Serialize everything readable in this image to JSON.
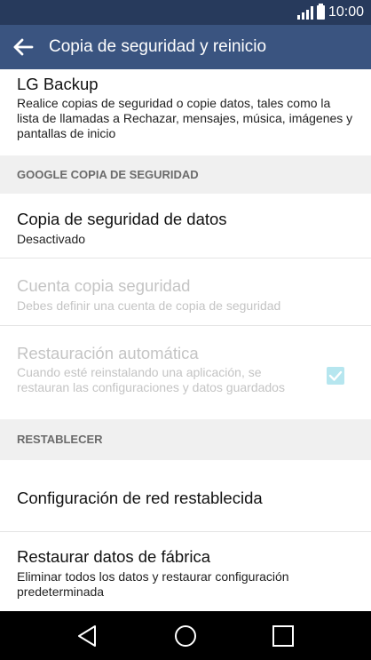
{
  "status_bar": {
    "time": "10:00"
  },
  "app_bar": {
    "title": "Copia de seguridad y reinicio",
    "back_icon": "arrow-left-icon"
  },
  "lg_backup": {
    "title": "LG Backup",
    "subtitle": "Realice copias de seguridad o copie datos, tales como la lista de llamadas a Rechazar, mensajes, música, imágenes y pantallas de inicio"
  },
  "sections": {
    "google": "GOOGLE COPIA DE SEGURIDAD",
    "reset": "RESTABLECER"
  },
  "backup_data": {
    "title": "Copia de seguridad de datos",
    "subtitle": "Desactivado"
  },
  "backup_account": {
    "title": "Cuenta copia seguridad",
    "subtitle": "Debes definir una cuenta de copia de seguridad"
  },
  "auto_restore": {
    "title": "Restauración automática",
    "subtitle": "Cuando esté reinstalando una aplicación, se restauran las configuraciones y datos guardados",
    "checked": true
  },
  "network_reset": {
    "title": "Configuración de red restablecida"
  },
  "factory_reset": {
    "title": "Restaurar datos de fábrica",
    "subtitle": "Eliminar todos los datos y restaurar configuración predeterminada"
  },
  "nav_bar": {
    "back_icon": "triangle-back-icon",
    "home_icon": "circle-home-icon",
    "recents_icon": "square-recents-icon"
  },
  "colors": {
    "status_bar": "#273a5c",
    "app_bar": "#3a5480",
    "section_bg": "#f0f0f0",
    "checkbox": "#b6e6ef"
  }
}
